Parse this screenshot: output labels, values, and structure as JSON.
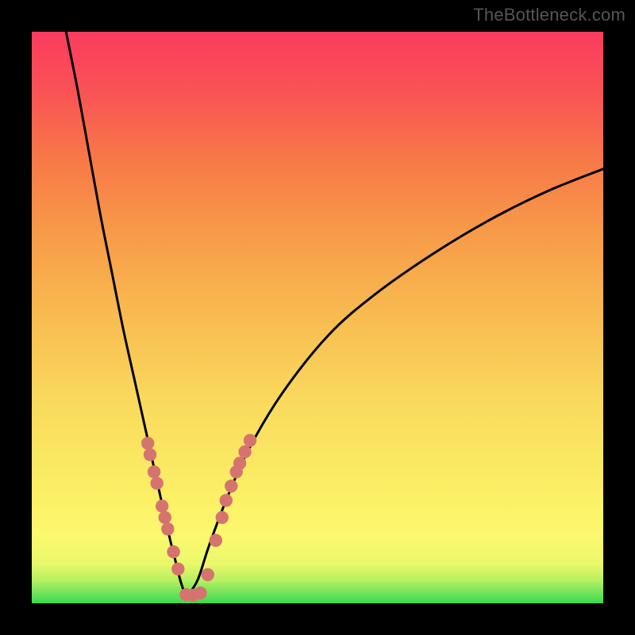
{
  "watermark": "TheBottleneck.com",
  "colors": {
    "gradient_top": "#fa3b5e",
    "gradient_bottom": "#39db4f",
    "curve": "#000000",
    "markers": "#d5746e",
    "frame": "#000000"
  },
  "chart_data": {
    "type": "line",
    "title": "",
    "xlabel": "",
    "ylabel": "",
    "xlim": [
      0,
      100
    ],
    "ylim": [
      0,
      100
    ],
    "legend": false,
    "grid": false,
    "notes": "V-shaped bottleneck curve with min near x≈27; color gradient encodes y (green low, red high); pink markers on both branches near bottom.",
    "series": [
      {
        "name": "left-branch",
        "x": [
          6,
          8,
          10,
          12,
          14,
          16,
          18,
          20,
          22,
          24,
          25,
          26,
          27
        ],
        "y": [
          100,
          90,
          79,
          68,
          58,
          48,
          39,
          30,
          21,
          12,
          8,
          4,
          1
        ]
      },
      {
        "name": "right-branch",
        "x": [
          27,
          29,
          31,
          34,
          38,
          44,
          52,
          60,
          70,
          80,
          90,
          100
        ],
        "y": [
          1,
          4,
          10,
          18,
          27,
          37,
          47,
          54,
          61,
          67,
          72,
          76
        ]
      }
    ],
    "markers": {
      "name": "highlighted-points",
      "points": [
        {
          "x": 20.3,
          "y": 28
        },
        {
          "x": 20.7,
          "y": 26
        },
        {
          "x": 21.4,
          "y": 23
        },
        {
          "x": 21.9,
          "y": 21
        },
        {
          "x": 22.8,
          "y": 17
        },
        {
          "x": 23.3,
          "y": 15
        },
        {
          "x": 23.8,
          "y": 13
        },
        {
          "x": 24.8,
          "y": 9
        },
        {
          "x": 25.6,
          "y": 6
        },
        {
          "x": 27.0,
          "y": 1.5
        },
        {
          "x": 28.2,
          "y": 1.4
        },
        {
          "x": 29.5,
          "y": 1.8
        },
        {
          "x": 30.8,
          "y": 5
        },
        {
          "x": 32.2,
          "y": 11
        },
        {
          "x": 33.3,
          "y": 15
        },
        {
          "x": 34.0,
          "y": 18
        },
        {
          "x": 34.9,
          "y": 20.5
        },
        {
          "x": 35.8,
          "y": 23
        },
        {
          "x": 36.4,
          "y": 24.5
        },
        {
          "x": 37.3,
          "y": 26.5
        },
        {
          "x": 38.2,
          "y": 28.5
        }
      ]
    }
  }
}
